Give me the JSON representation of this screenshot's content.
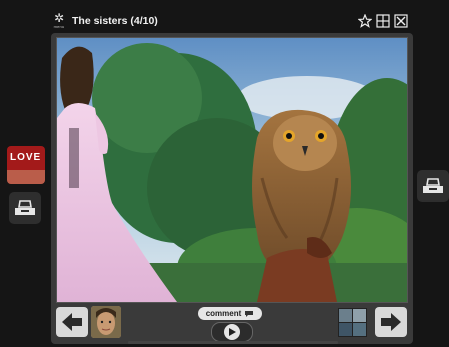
{
  "viewer": {
    "title": "The sisters (4/10)",
    "menu_label": "menu",
    "comment_label": "comment",
    "love_label": "LOVE"
  },
  "icons": {
    "menu": "gear-icon",
    "favorite": "star-icon",
    "fullscreen": "expand-icon",
    "close": "close-icon",
    "prev": "arrow-left-icon",
    "next": "arrow-right-icon",
    "play": "play-icon",
    "tray": "tray-icon"
  },
  "colors": {
    "background": "#151515",
    "frame": "#3a3a3a",
    "button": "#d9d9d9"
  }
}
